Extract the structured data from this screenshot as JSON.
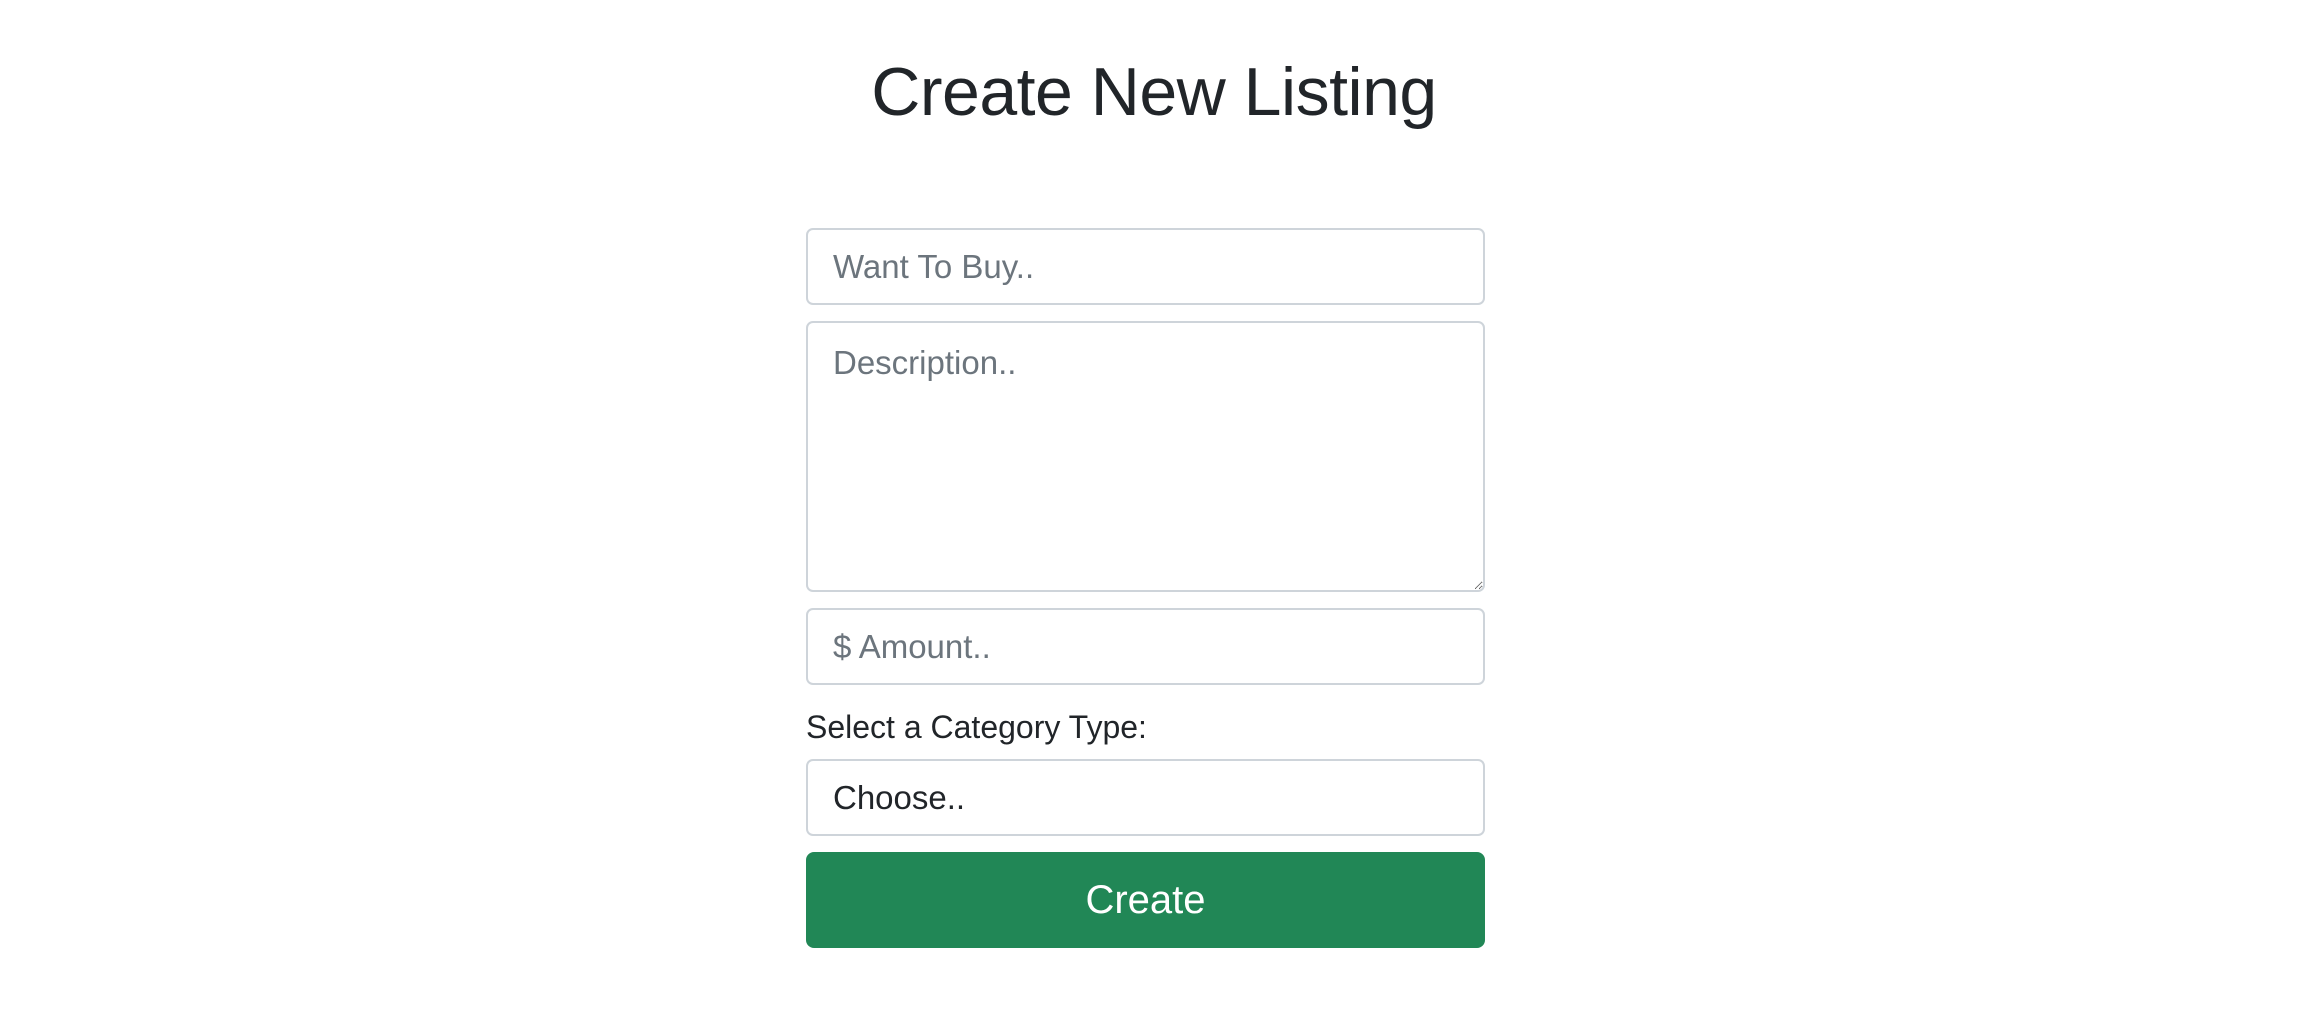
{
  "page": {
    "title": "Create New Listing"
  },
  "form": {
    "title_input": {
      "placeholder": "Want To Buy..",
      "value": ""
    },
    "description_input": {
      "placeholder": "Description..",
      "value": ""
    },
    "amount_input": {
      "placeholder": "$ Amount..",
      "value": ""
    },
    "category_label": "Select a Category Type:",
    "category_select": {
      "selected": "Choose.."
    },
    "submit_label": "Create"
  },
  "colors": {
    "primary_button": "#218756",
    "border": "#ced4da",
    "placeholder": "#6c757d",
    "text": "#212529"
  }
}
